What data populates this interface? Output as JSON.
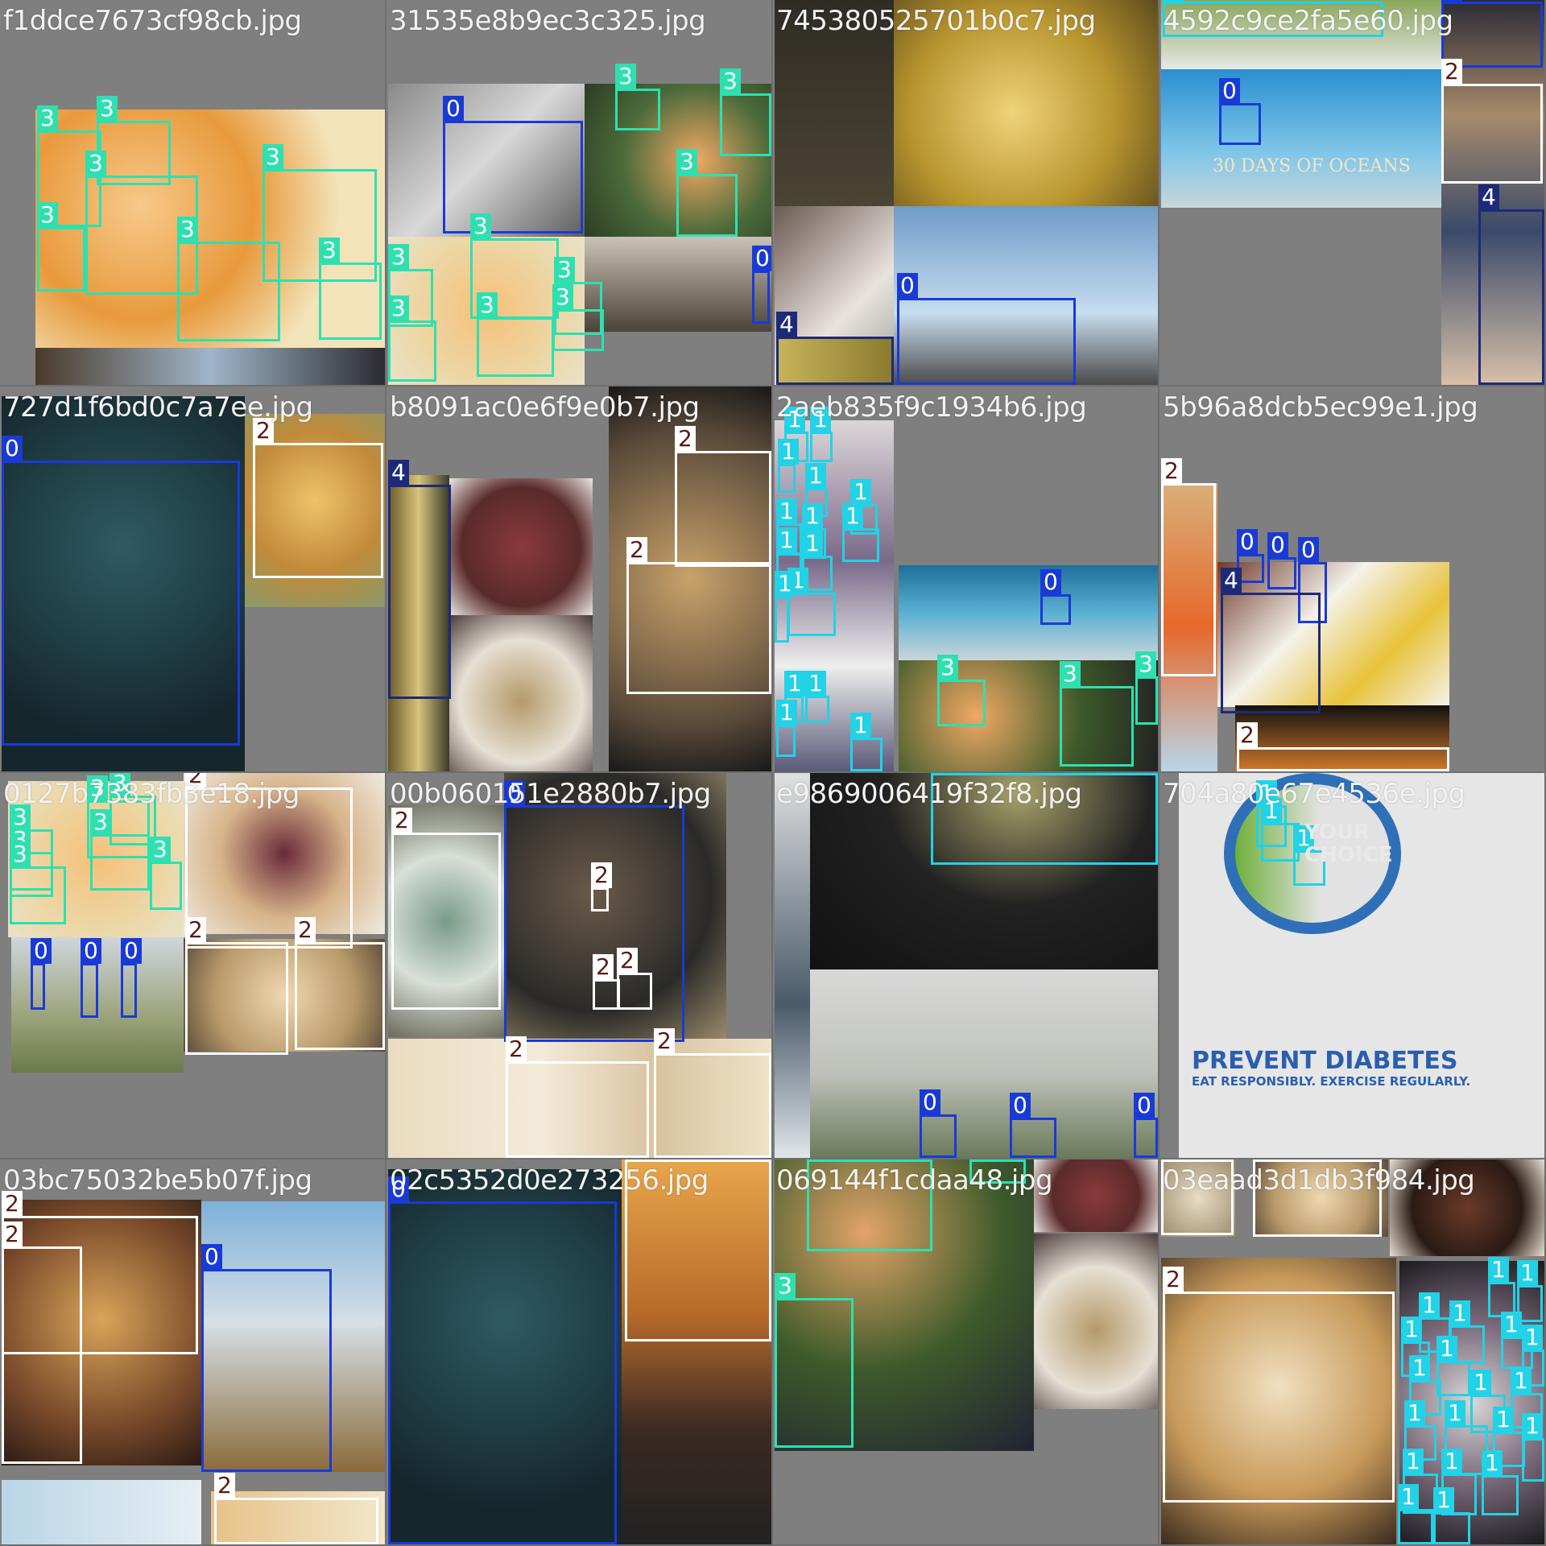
{
  "tiles": [
    {
      "filename": "f1ddce7673cf98cb.jpg"
    },
    {
      "filename": "31535e8b9ec3c325.jpg"
    },
    {
      "filename": "745380525701b0c7.jpg"
    },
    {
      "filename": "4592c9ce2fa5e60.jpg"
    },
    {
      "filename": "727d1f6bd0c7a7ee.jpg"
    },
    {
      "filename": "b8091ac0e6f9e0b7.jpg"
    },
    {
      "filename": "2aeb835f9c1934b6.jpg"
    },
    {
      "filename": "5b96a8dcb5ec99e1.jpg"
    },
    {
      "filename": "0127b7383fb3e18.jpg"
    },
    {
      "filename": "00b060151e2880b7.jpg"
    },
    {
      "filename": "e9869006419f32f8.jpg"
    },
    {
      "filename": "704a80e67e4536e.jpg"
    },
    {
      "filename": "03bc75032be5b07f.jpg"
    },
    {
      "filename": "02c5352d0e273256.jpg"
    },
    {
      "filename": "069144f1cdaa48.jpg"
    },
    {
      "filename": "03eaad3d1db3f984.jpg"
    }
  ],
  "box_labels": {
    "c0": "0",
    "c1": "1",
    "c2": "2",
    "c3": "3",
    "c4": "4"
  },
  "colors": {
    "class0": "#1a3ad6",
    "class1": "#22d2e6",
    "class2": "#ffffff",
    "class3": "#2ee0b0",
    "class4": "#1c2a78"
  },
  "overlay_text": {
    "ocean_banner": "30 DAYS OF OCEANS",
    "poster_headline": "PREVENT DIABETES",
    "poster_sub": "EAT RESPONSIBLY. EXERCISE REGULARLY.",
    "poster_choice": "YOUR CHOICE"
  }
}
